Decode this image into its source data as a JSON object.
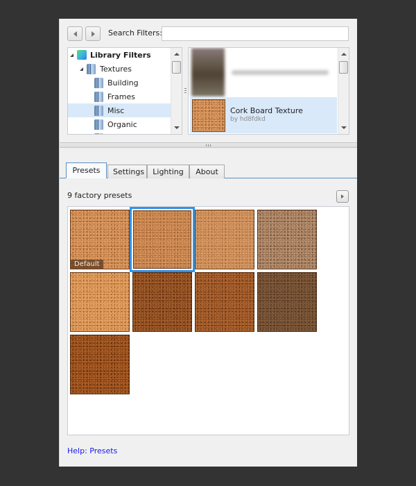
{
  "toolbar": {
    "back_icon": "back-arrow",
    "forward_icon": "forward-arrow",
    "search_label": "Search Filters:",
    "search_value": "",
    "search_placeholder": ""
  },
  "tree": {
    "items": [
      {
        "label": "Library Filters",
        "icon": "library-cube",
        "expanded": true,
        "level": 0,
        "bold": true
      },
      {
        "label": "Textures",
        "icon": "folder",
        "expanded": true,
        "level": 1
      },
      {
        "label": "Building",
        "icon": "folder",
        "level": 2
      },
      {
        "label": "Frames",
        "icon": "folder",
        "level": 2
      },
      {
        "label": "Misc",
        "icon": "folder",
        "level": 2,
        "selected": true
      },
      {
        "label": "Organic",
        "icon": "folder",
        "level": 2
      }
    ]
  },
  "thumb_list": {
    "blurred_item": true,
    "selected_item": {
      "title": "Cork Board Texture",
      "author": "by hd8fdkd"
    }
  },
  "tabs": [
    {
      "label": "Presets",
      "active": true
    },
    {
      "label": "Settings"
    },
    {
      "label": "Lighting"
    },
    {
      "label": "About"
    }
  ],
  "presets": {
    "count_label": "9 factory presets",
    "default_badge": "Default",
    "selected_index": 1,
    "items": [
      {
        "name": "preset-1",
        "default": true,
        "base": "#c8834a",
        "light": "#e2a26a",
        "dark": "#9a5d2e"
      },
      {
        "name": "preset-2",
        "base": "#c17c48",
        "light": "#d9985f",
        "dark": "#9c5f34"
      },
      {
        "name": "preset-3",
        "base": "#c78551",
        "light": "#dba06a",
        "dark": "#a8693c"
      },
      {
        "name": "preset-4",
        "base": "#9e7658",
        "light": "#bf9877",
        "dark": "#6e4e36"
      },
      {
        "name": "preset-5",
        "base": "#d08a4c",
        "light": "#eaa96a",
        "dark": "#a8662e"
      },
      {
        "name": "preset-6",
        "base": "#86461c",
        "light": "#a9632f",
        "dark": "#5c2c0e"
      },
      {
        "name": "preset-7",
        "base": "#944e20",
        "light": "#b46b35",
        "dark": "#6a3512"
      },
      {
        "name": "preset-8",
        "base": "#6b482e",
        "light": "#86603f",
        "dark": "#4e321e"
      },
      {
        "name": "preset-9",
        "base": "#8e4716",
        "light": "#b3642b",
        "dark": "#5f2c0b"
      }
    ]
  },
  "help": {
    "label": "Help: Presets"
  },
  "colors": {
    "accent": "#3392e8",
    "selection": "#d9e9f9",
    "link": "#1a1aee",
    "background": "#333333",
    "panel": "#f0f0f0"
  }
}
